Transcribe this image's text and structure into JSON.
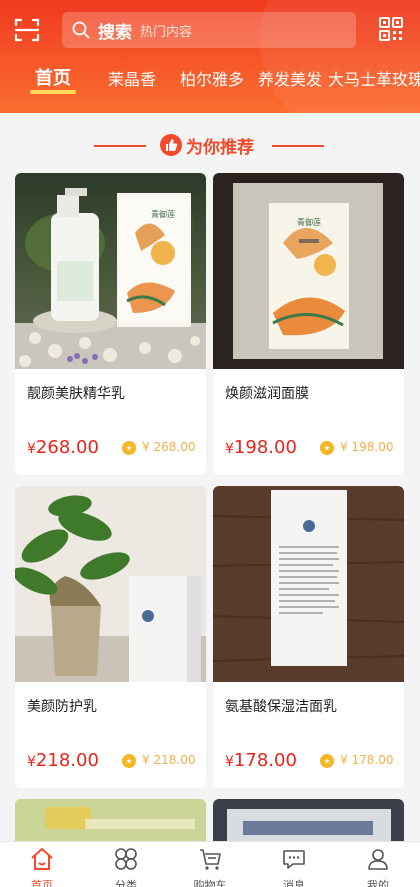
{
  "header": {
    "search_label": "搜索",
    "search_hint": "热门内容"
  },
  "tabs": [
    {
      "label": "首页",
      "active": true
    },
    {
      "label": "茉晶香"
    },
    {
      "label": "柏尔雅多"
    },
    {
      "label": "养发美发"
    },
    {
      "label": "大马士革玫瑰"
    }
  ],
  "section": {
    "title": "为你推荐"
  },
  "products": [
    {
      "name": "靓颜美肤精华乳",
      "price": "268.00",
      "points": "268.00",
      "box_text": "青御莲"
    },
    {
      "name": "焕颜滋润面膜",
      "price": "198.00",
      "points": "198.00",
      "box_text": "青御莲"
    },
    {
      "name": "美颜防护乳",
      "price": "218.00",
      "points": "218.00"
    },
    {
      "name": "氨基酸保湿洁面乳",
      "price": "178.00",
      "points": "178.00"
    }
  ],
  "currency": "¥",
  "bottom_nav": [
    {
      "label": "首页",
      "icon": "home-icon",
      "active": true
    },
    {
      "label": "分类",
      "icon": "category-icon"
    },
    {
      "label": "购物车",
      "icon": "cart-icon"
    },
    {
      "label": "消息",
      "icon": "message-icon"
    },
    {
      "label": "我的",
      "icon": "profile-icon"
    }
  ],
  "colors": {
    "accent": "#f24b2c",
    "price": "#e8241c",
    "tab_underline": "#ffd95a"
  }
}
